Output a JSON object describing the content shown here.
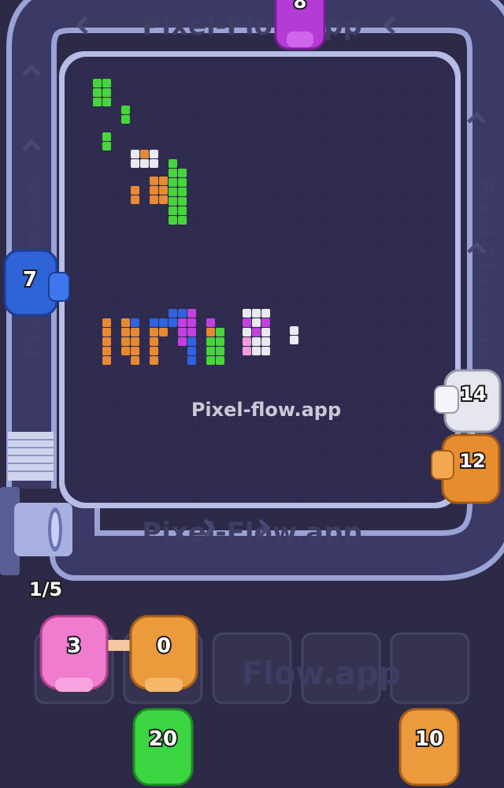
{
  "watermark": "Pixel-flow.app",
  "track_text": {
    "top": "Pixel-Flow.app",
    "bottom": "Pixel-Flow.app",
    "left": "Pixel-Flow.app",
    "right": "Pixel-Flow.app",
    "tray": "Flow.app"
  },
  "queue_counter": "1/5",
  "track_pigs": [
    {
      "id": "purple",
      "count": "8",
      "color": "#b53bd6"
    },
    {
      "id": "blue",
      "count": "7",
      "color": "#2f63d8"
    },
    {
      "id": "white",
      "count": "14",
      "color": "#e6e6ee"
    },
    {
      "id": "orange",
      "count": "12",
      "color": "#e88d2f"
    }
  ],
  "slot_pigs": [
    {
      "id": "pink",
      "count": "3",
      "color": "#f07ccf"
    },
    {
      "id": "orange",
      "count": "0",
      "color": "#eb9a3c"
    }
  ],
  "waiting_pigs": [
    {
      "id": "green",
      "count": "20",
      "color": "#3bd642"
    },
    {
      "id": "orange",
      "count": "10",
      "color": "#eb9a3c"
    }
  ],
  "pixel_colors": {
    "green": "#46d63a",
    "orange": "#e78a31",
    "white": "#e9e9f0",
    "blue": "#2e64df",
    "magenta": "#c241e0",
    "pink": "#f29bdc"
  }
}
